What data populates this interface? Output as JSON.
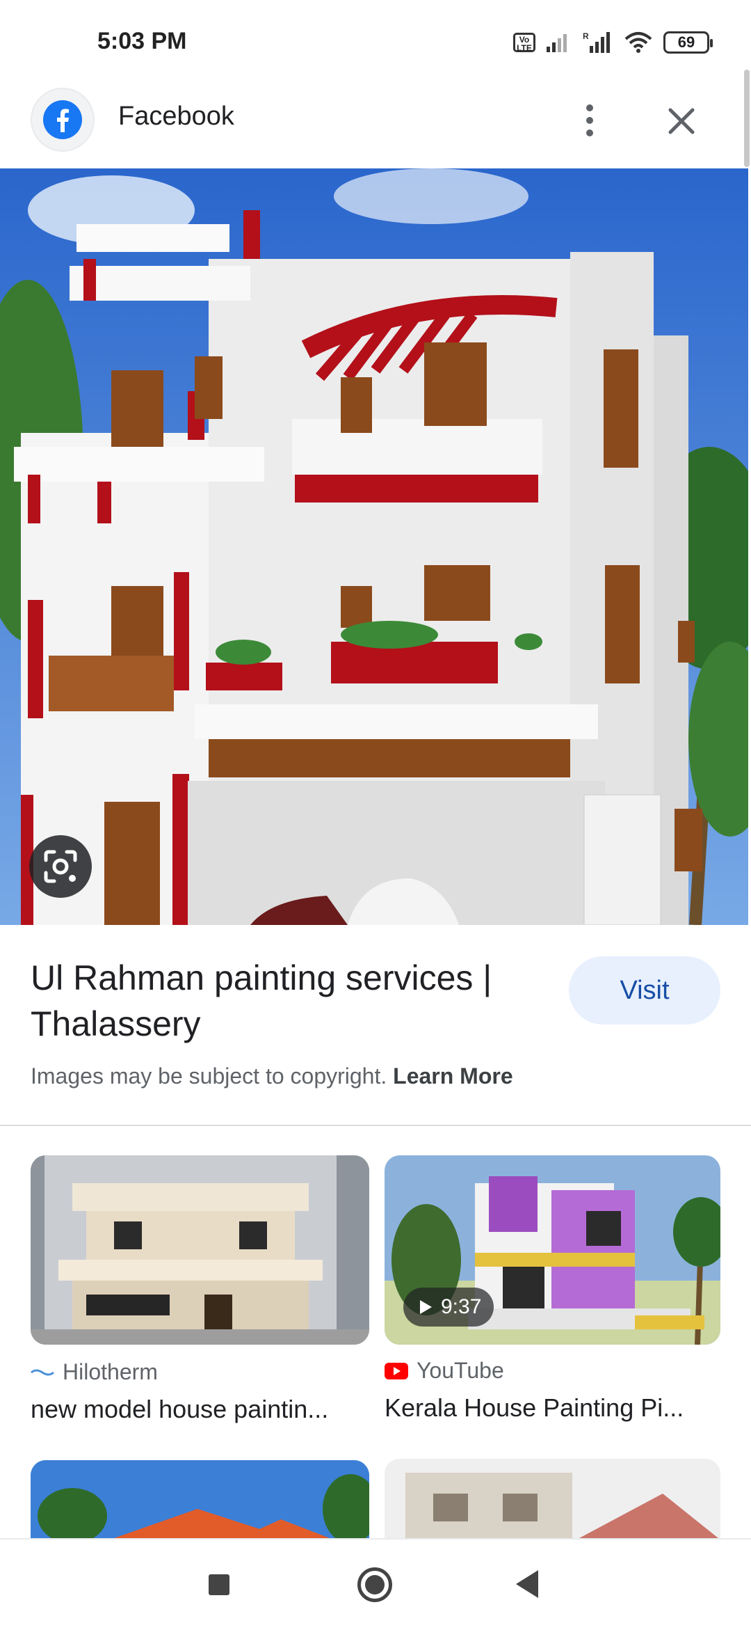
{
  "status_bar": {
    "time": "5:03 PM",
    "volte": "Vo LTE",
    "battery": "69"
  },
  "header": {
    "title": "Facebook",
    "icons": [
      "facebook-logo",
      "more-vert-icon",
      "close-icon"
    ]
  },
  "result": {
    "title": "Ul Rahman painting services | Thalassery",
    "visit_label": "Visit",
    "copyright_text": "Images may be subject to copyright.",
    "learn_more": "Learn More"
  },
  "related": [
    {
      "source": "Hilotherm",
      "title": "new model house paintin...",
      "has_video": false
    },
    {
      "source": "YouTube",
      "title": "Kerala House Painting Pi...",
      "duration": "9:37",
      "has_video": true
    }
  ],
  "colors": {
    "accent": "#1a73e8",
    "visit_bg": "#e8f0fe",
    "house_red": "#b3101a",
    "sky": "#2f6fd0"
  }
}
